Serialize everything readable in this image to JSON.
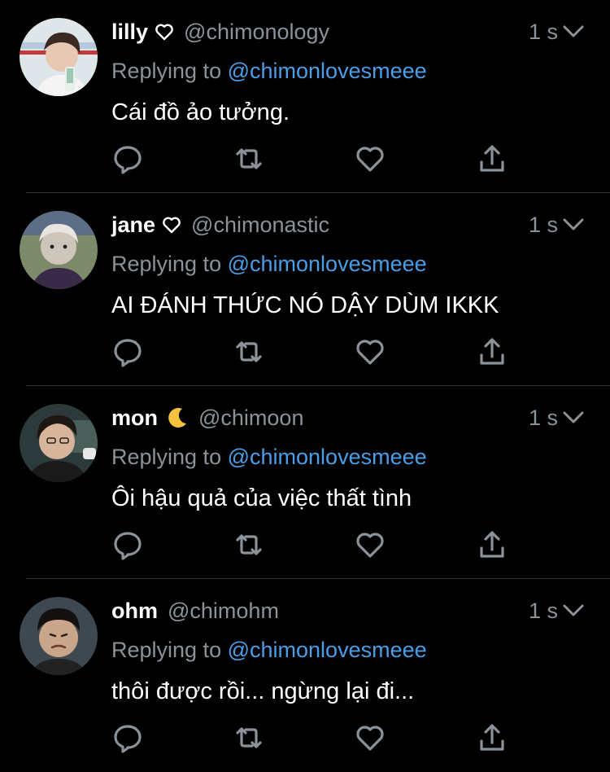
{
  "colors": {
    "background": "#000000",
    "muted": "#8b9299",
    "link": "#4a9ee8",
    "divider": "#2f3336"
  },
  "tweets": [
    {
      "name": "lilly",
      "name_emoji": "heart-outline",
      "handle": "@chimonology",
      "time": "1 s",
      "reply_prefix": "Replying to",
      "reply_target": "@chimonlovesmeee",
      "text": "Cái đồ ảo tưởng."
    },
    {
      "name": "jane",
      "name_emoji": "heart-outline",
      "handle": "@chimonastic",
      "time": "1 s",
      "reply_prefix": "Replying to",
      "reply_target": "@chimonlovesmeee",
      "text": "AI ĐÁNH THỨC NÓ DẬY DÙM IKKK"
    },
    {
      "name": "mon",
      "name_emoji": "crescent-moon",
      "handle": "@chimoon",
      "time": "1 s",
      "reply_prefix": "Replying to",
      "reply_target": "@chimonlovesmeee",
      "text": "Ôi hậu quả của việc thất tình"
    },
    {
      "name": "ohm",
      "name_emoji": "",
      "handle": "@chimohm",
      "time": "1 s",
      "reply_prefix": "Replying to",
      "reply_target": "@chimonlovesmeee",
      "text": "thôi được rồi... ngừng lại đi..."
    }
  ],
  "action_icons": [
    "reply-icon",
    "retweet-icon",
    "like-icon",
    "share-icon"
  ]
}
